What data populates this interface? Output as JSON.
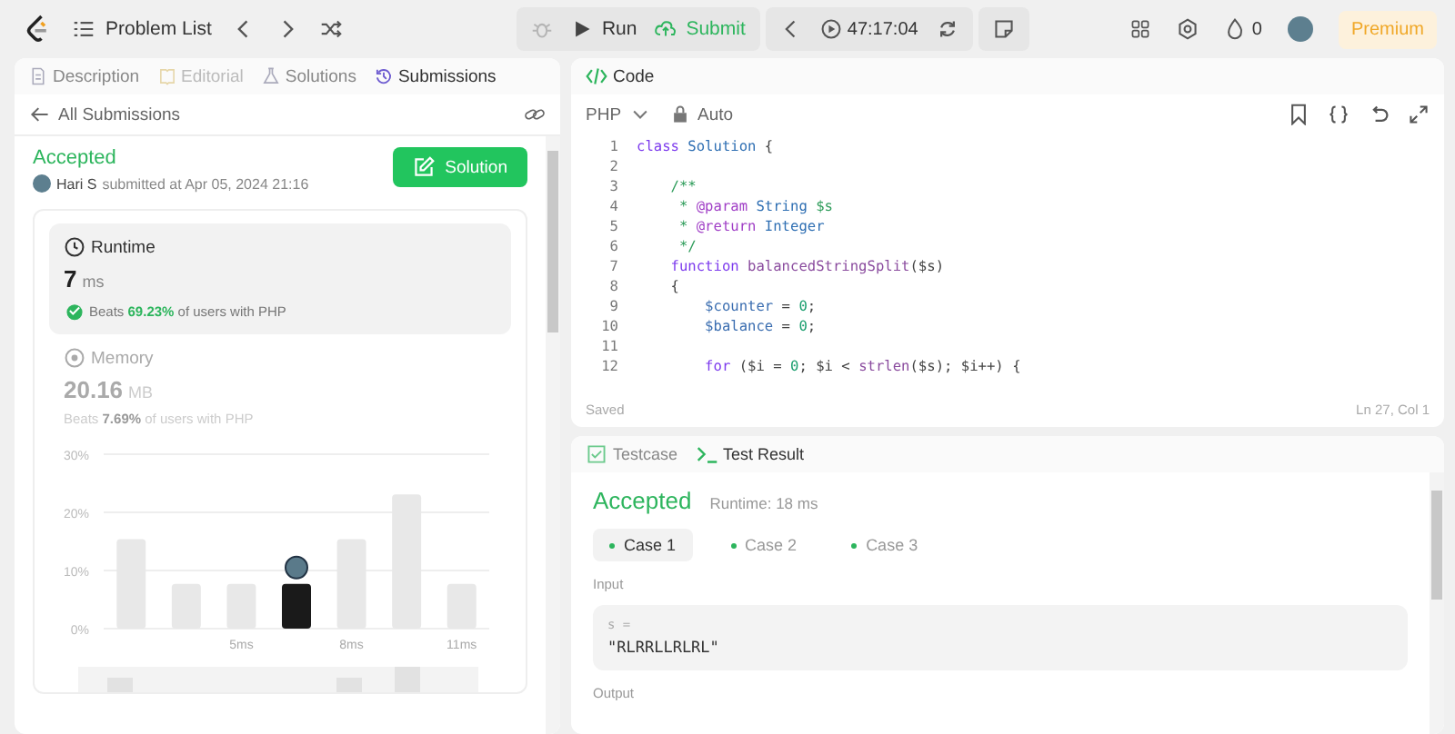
{
  "topbar": {
    "problem_list": "Problem List",
    "run": "Run",
    "submit": "Submit",
    "timer": "47:17:04",
    "streak": "0",
    "premium": "Premium"
  },
  "left": {
    "tabs": [
      {
        "label": "Description",
        "selected": false,
        "disabled": false
      },
      {
        "label": "Editorial",
        "selected": false,
        "disabled": true
      },
      {
        "label": "Solutions",
        "selected": false,
        "disabled": false
      },
      {
        "label": "Submissions",
        "selected": true,
        "disabled": false
      }
    ],
    "back": "All Submissions",
    "status": "Accepted",
    "user": "Hari S",
    "submitted": "submitted at Apr 05, 2024 21:16",
    "solution_button": "Solution",
    "runtime": {
      "title": "Runtime",
      "value": "7",
      "unit": "ms",
      "beats": "Beats **69.23%** of users with PHP"
    },
    "memory": {
      "title": "Memory",
      "value": "20.16",
      "unit": "MB",
      "beats": "Beats **7.69%** of users with PHP"
    },
    "chart_data": {
      "type": "bar",
      "x": [
        2,
        3.5,
        5,
        6.5,
        8,
        9.5,
        11
      ],
      "values": [
        15.4,
        7.7,
        7.7,
        7.7,
        15.4,
        23.1,
        7.7
      ],
      "ylim": [
        0,
        30
      ],
      "yticks": [
        {
          "value": 0,
          "label": "0%"
        },
        {
          "value": 10,
          "label": "10%"
        },
        {
          "value": 20,
          "label": "20%"
        },
        {
          "value": 30,
          "label": "30%"
        }
      ],
      "xticks": [
        {
          "value": 5,
          "label": "5ms"
        },
        {
          "value": 8,
          "label": "8ms"
        },
        {
          "value": 11,
          "label": "11ms"
        }
      ],
      "xlim": [
        1.25,
        11.75
      ]
    },
    "chart_bars": [
      {
        "selected": false
      },
      {
        "selected": false
      },
      {
        "selected": false
      },
      {
        "selected": true
      },
      {
        "selected": false
      },
      {
        "selected": false
      },
      {
        "selected": false
      }
    ]
  },
  "code": {
    "title": "Code",
    "language": "PHP",
    "mode": "Auto",
    "saved": "Saved",
    "cursor": "Ln 27, Col 1",
    "lines": [
      {
        "number": "1",
        "tokens": [
          {
            "kind": "kw",
            "text": "class "
          },
          {
            "kind": "cls",
            "text": "Solution"
          },
          {
            "kind": "plain",
            "text": " {"
          }
        ]
      },
      {
        "number": "2"
      },
      {
        "number": "3",
        "tokens": [
          {
            "kind": "cm",
            "text": "    /**"
          }
        ]
      },
      {
        "number": "4",
        "tokens": [
          {
            "kind": "cm",
            "text": "     * "
          },
          {
            "kind": "tag",
            "text": "@param"
          },
          {
            "kind": "cls",
            "text": " String"
          },
          {
            "kind": "cm",
            "text": " $s"
          }
        ]
      },
      {
        "number": "5",
        "tokens": [
          {
            "kind": "cm",
            "text": "     * "
          },
          {
            "kind": "tag",
            "text": "@return"
          },
          {
            "kind": "cls",
            "text": " Integer"
          }
        ]
      },
      {
        "number": "6",
        "tokens": [
          {
            "kind": "cm",
            "text": "     */"
          }
        ]
      },
      {
        "number": "7",
        "tokens": [
          {
            "kind": "kw",
            "text": "    function "
          },
          {
            "kind": "fn",
            "text": "balancedStringSplit"
          },
          {
            "kind": "plain",
            "text": "($s)"
          }
        ]
      },
      {
        "number": "8",
        "tokens": [
          {
            "kind": "plain",
            "text": "    {"
          }
        ]
      },
      {
        "number": "9",
        "tokens": [
          {
            "kind": "var",
            "text": "        $counter"
          },
          {
            "kind": "plain",
            "text": " = "
          },
          {
            "kind": "num",
            "text": "0"
          },
          {
            "kind": "plain",
            "text": ";"
          }
        ]
      },
      {
        "number": "10",
        "tokens": [
          {
            "kind": "var",
            "text": "        $balance"
          },
          {
            "kind": "plain",
            "text": " = "
          },
          {
            "kind": "num",
            "text": "0"
          },
          {
            "kind": "plain",
            "text": ";"
          }
        ]
      },
      {
        "number": "11"
      },
      {
        "number": "12",
        "tokens": [
          {
            "kind": "kw",
            "text": "        for"
          },
          {
            "kind": "plain",
            "text": " ($i = "
          },
          {
            "kind": "num",
            "text": "0"
          },
          {
            "kind": "plain",
            "text": "; $i < "
          },
          {
            "kind": "fn",
            "text": "strlen"
          },
          {
            "kind": "plain",
            "text": "($s); $i++) {"
          }
        ]
      }
    ]
  },
  "result": {
    "tabs": [
      {
        "label": "Testcase",
        "selected": false
      },
      {
        "label": "Test Result",
        "selected": true
      }
    ],
    "status": "Accepted",
    "runtime": "Runtime: 18 ms",
    "cases": [
      {
        "label": "Case 1",
        "selected": true
      },
      {
        "label": "Case 2",
        "selected": false
      },
      {
        "label": "Case 3",
        "selected": false
      }
    ],
    "input_label": "Input",
    "var_name": "s =",
    "var_value": "\"RLRRLLRLRL\"",
    "output_label": "Output"
  }
}
